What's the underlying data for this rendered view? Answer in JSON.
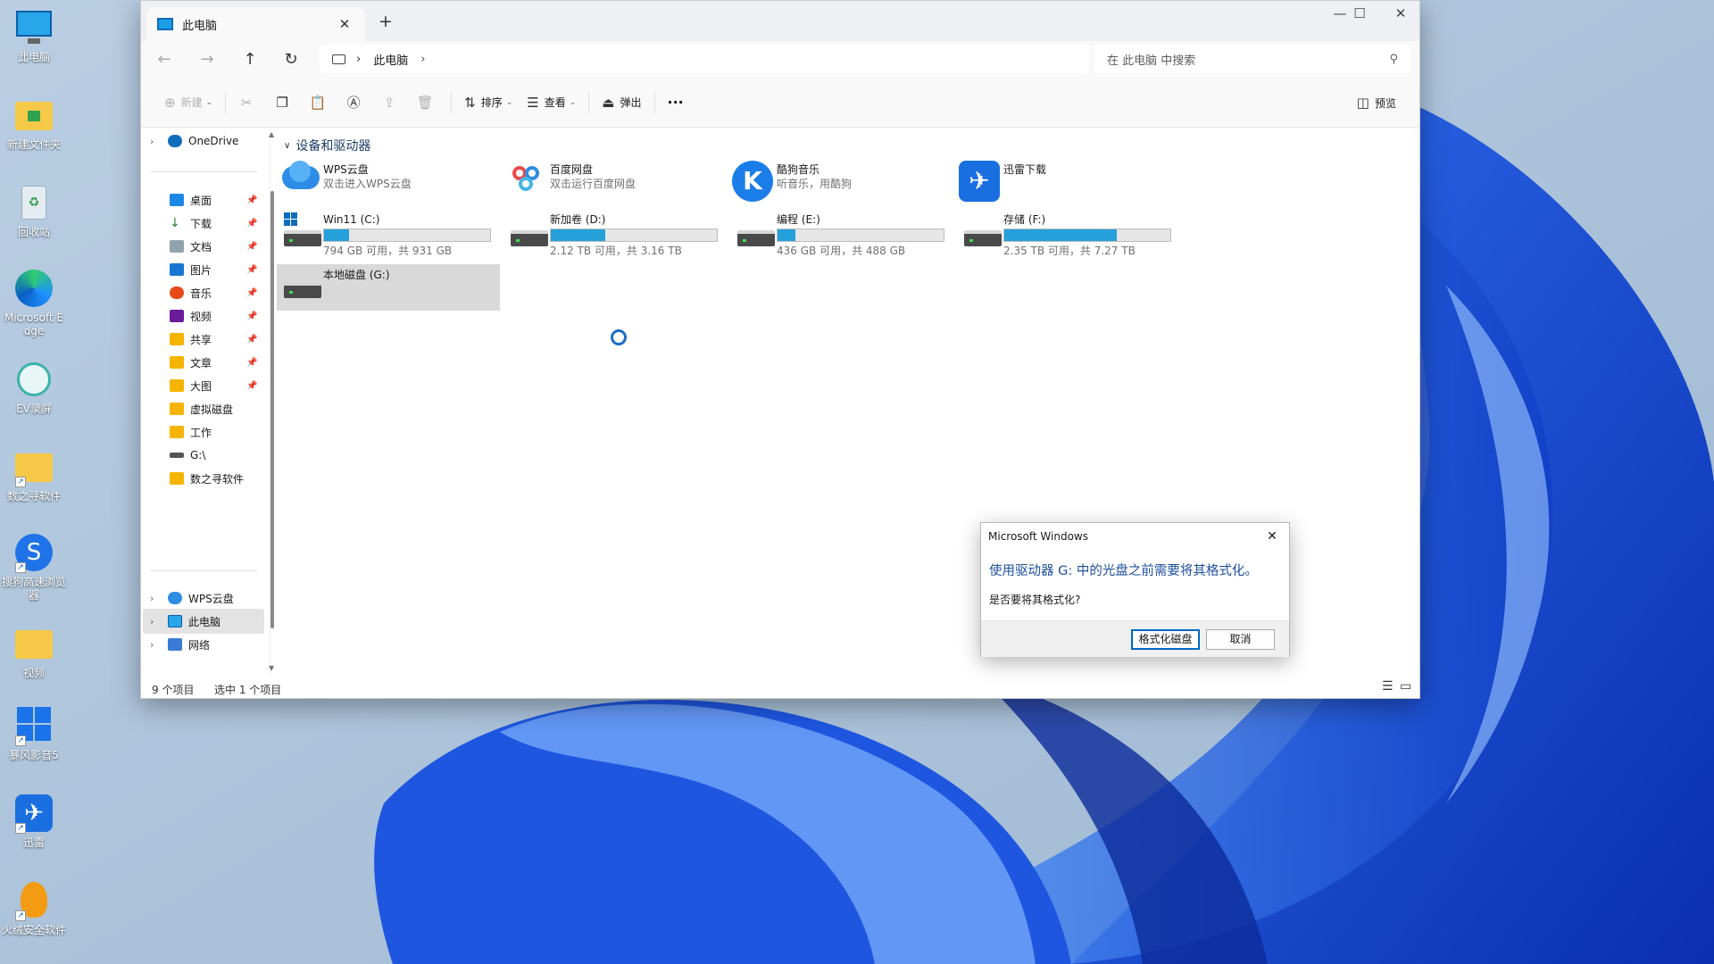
{
  "desktop": {
    "icons": [
      {
        "label": "此电脑"
      },
      {
        "label": "新建文件夹"
      },
      {
        "label": "回收站"
      },
      {
        "label": "Microsoft Edge"
      },
      {
        "label": "EV录屏"
      },
      {
        "label": "数之寻软件"
      },
      {
        "label": "搜狗高速浏览器"
      },
      {
        "label": "视频"
      },
      {
        "label": "暴风影音5"
      },
      {
        "label": "迅雷"
      },
      {
        "label": "火绒安全软件"
      }
    ]
  },
  "window": {
    "tab_title": "此电脑",
    "tab_close": "✕",
    "new_tab": "+",
    "controls": {
      "minimize": "—",
      "maximize": "☐",
      "close": "✕"
    }
  },
  "address": {
    "breadcrumb": [
      "此电脑"
    ],
    "search_placeholder": "在 此电脑 中搜索"
  },
  "toolbar": {
    "new_label": "新建",
    "sort_label": "排序",
    "view_label": "查看",
    "eject_label": "弹出",
    "more_label": "···",
    "preview_label": "预览"
  },
  "sidebar": {
    "onedrive": "OneDrive",
    "quick_access": [
      {
        "label": "桌面",
        "pinned": true,
        "color": "#1e88e5"
      },
      {
        "label": "下载",
        "pinned": true,
        "color": "#2e7d32"
      },
      {
        "label": "文档",
        "pinned": true,
        "color": "#78909c"
      },
      {
        "label": "图片",
        "pinned": true,
        "color": "#1976d2"
      },
      {
        "label": "音乐",
        "pinned": true,
        "color": "#e64a19"
      },
      {
        "label": "视频",
        "pinned": true,
        "color": "#6a1b9a"
      },
      {
        "label": "共享",
        "pinned": true,
        "color": "#f4b400"
      },
      {
        "label": "文章",
        "pinned": true,
        "color": "#f4b400"
      },
      {
        "label": "大图",
        "pinned": true,
        "color": "#f4b400"
      },
      {
        "label": "虚拟磁盘",
        "pinned": false,
        "color": "#f4b400"
      },
      {
        "label": "工作",
        "pinned": false,
        "color": "#f4b400"
      },
      {
        "label": "G:\\",
        "pinned": false,
        "color": "#555555"
      },
      {
        "label": "数之寻软件",
        "pinned": false,
        "color": "#f4b400"
      }
    ],
    "bottom": [
      {
        "label": "WPS云盘"
      },
      {
        "label": "此电脑"
      },
      {
        "label": "网络"
      }
    ]
  },
  "content": {
    "group_header": "设备和驱动器",
    "apps": [
      {
        "name": "WPS云盘",
        "sub": "双击进入WPS云盘"
      },
      {
        "name": "百度网盘",
        "sub": "双击运行百度网盘"
      },
      {
        "name": "酷狗音乐",
        "sub": "听音乐，用酷狗"
      },
      {
        "name": "迅雷下载",
        "sub": ""
      }
    ],
    "drives": [
      {
        "name": "Win11 (C:)",
        "free": "794 GB 可用，共 931 GB",
        "used_fraction": 0.15
      },
      {
        "name": "新加卷 (D:)",
        "free": "2.12 TB 可用，共 3.16 TB",
        "used_fraction": 0.33
      },
      {
        "name": "编程 (E:)",
        "free": "436 GB 可用，共 488 GB",
        "used_fraction": 0.11
      },
      {
        "name": "存储 (F:)",
        "free": "2.35 TB 可用，共 7.27 TB",
        "used_fraction": 0.68
      },
      {
        "name": "本地磁盘 (G:)"
      }
    ]
  },
  "status": {
    "count": "9 个项目",
    "selected": "选中 1 个项目"
  },
  "dialog": {
    "title": "Microsoft Windows",
    "message": "使用驱动器 G: 中的光盘之前需要将其格式化。",
    "question": "是否要将其格式化?",
    "format_button": "格式化磁盘",
    "cancel_button": "取消",
    "close": "✕"
  },
  "colors": {
    "accent": "#26a0da",
    "dialog_text": "#1c4f9c"
  }
}
